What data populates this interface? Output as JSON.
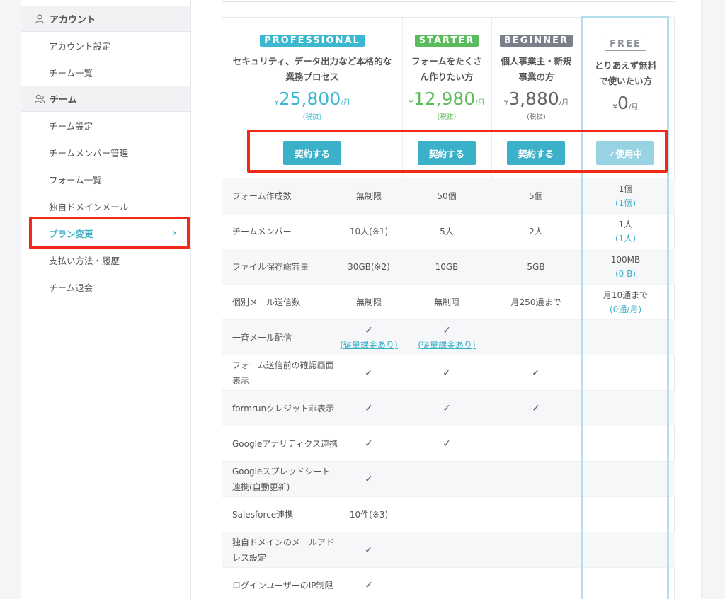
{
  "sidebar": {
    "sections": [
      {
        "title": "アカウント",
        "icon": "user-icon",
        "items": [
          {
            "label": "アカウント設定"
          },
          {
            "label": "チーム一覧"
          }
        ]
      },
      {
        "title": "チーム",
        "icon": "users-icon",
        "items": [
          {
            "label": "チーム設定"
          },
          {
            "label": "チームメンバー管理"
          },
          {
            "label": "フォーム一覧"
          },
          {
            "label": "独自ドメインメール"
          },
          {
            "label": "プラン変更",
            "active": true
          },
          {
            "label": "支払い方法・履歴"
          },
          {
            "label": "チーム退会"
          }
        ]
      }
    ],
    "chevron": "›"
  },
  "plans": {
    "professional": {
      "badge": "PROFESSIONAL",
      "desc1": "セキュリティ、データ出力など本格的な",
      "desc2": "業務プロセス",
      "yen": "¥",
      "price": "25,800",
      "per": "/月",
      "tax": "(税抜)",
      "button": "契約する"
    },
    "starter": {
      "badge": "STARTER",
      "desc1": "フォームをたくさ",
      "desc2": "ん作りたい方",
      "yen": "¥",
      "price": "12,980",
      "per": "/月",
      "tax": "(税抜)",
      "button": "契約する"
    },
    "beginner": {
      "badge": "BEGINNER",
      "desc1": "個人事業主・新規",
      "desc2": "事業の方",
      "yen": "¥",
      "price": "3,880",
      "per": "/月",
      "tax": "(税抜)",
      "button": "契約する"
    },
    "free": {
      "badge": "FREE",
      "desc1": "とりあえず無料",
      "desc2": "で使いたい方",
      "yen": "¥",
      "price": "0",
      "per": "/月",
      "button": "✓使用中"
    }
  },
  "features": [
    {
      "label": "フォーム作成数",
      "pro": "無制限",
      "starter": "50個",
      "beginner": "5個",
      "free": "1個",
      "free_sub": "(1個)"
    },
    {
      "label": "チームメンバー",
      "pro": "10人(※1)",
      "starter": "5人",
      "beginner": "2人",
      "free": "1人",
      "free_sub": "(1人)"
    },
    {
      "label": "ファイル保存総容量",
      "pro": "30GB(※2)",
      "starter": "10GB",
      "beginner": "5GB",
      "free": "100MB",
      "free_sub": "(0 B)"
    },
    {
      "label": "個別メール送信数",
      "pro": "無制限",
      "starter": "無制限",
      "beginner": "月250通まで",
      "free": "月10通まで",
      "free_sub": "(0通/月)"
    },
    {
      "label": "一斉メール配信",
      "pro": "✓",
      "pro_link": "(従量課金あり)",
      "starter": "✓",
      "starter_link": "(従量課金あり)",
      "beginner": "",
      "free": ""
    },
    {
      "label": "フォーム送信前の確認画面表示",
      "pro": "✓",
      "starter": "✓",
      "beginner": "✓",
      "free": ""
    },
    {
      "label": "formrunクレジット非表示",
      "pro": "✓",
      "starter": "✓",
      "beginner": "✓",
      "free": ""
    },
    {
      "label": "Googleアナリティクス連携",
      "pro": "✓",
      "starter": "✓",
      "beginner": "",
      "free": ""
    },
    {
      "label": "Googleスプレッドシート連携(自動更新)",
      "pro": "✓",
      "starter": "",
      "beginner": "",
      "free": ""
    },
    {
      "label": "Salesforce連携",
      "pro": "10件(※3)",
      "starter": "",
      "beginner": "",
      "free": ""
    },
    {
      "label": "独自ドメインのメールアドレス設定",
      "pro": "✓",
      "starter": "",
      "beginner": "",
      "free": ""
    },
    {
      "label": "ログインユーザーのIP制限",
      "pro": "✓",
      "starter": "",
      "beginner": "",
      "free": ""
    }
  ],
  "colors": {
    "accent": "#3bb0c9",
    "starter": "#5cbb5c",
    "highlight": "#f02a16"
  }
}
